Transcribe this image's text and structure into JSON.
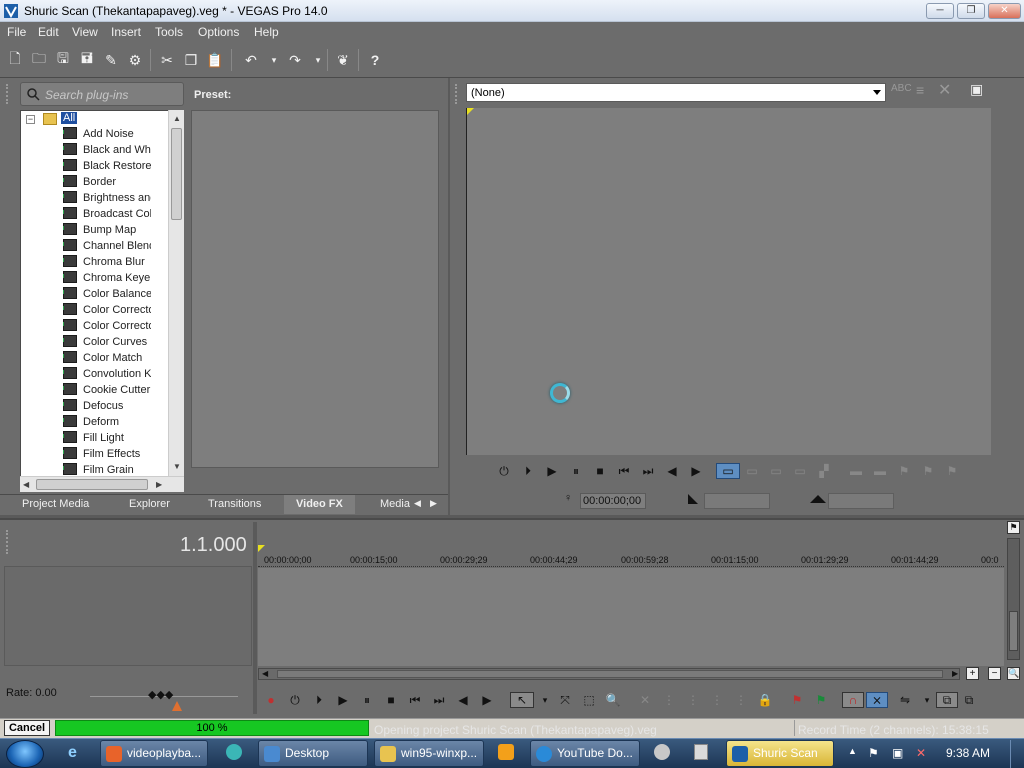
{
  "window": {
    "title": "Shuric Scan (Thekantapapaveg).veg * - VEGAS Pro 14.0",
    "min_glyph": "─",
    "max_glyph": "❐",
    "close_glyph": "✕"
  },
  "menu": {
    "items": [
      "File",
      "Edit",
      "View",
      "Insert",
      "Tools",
      "Options",
      "Help"
    ]
  },
  "toolbar": {
    "icons": [
      "new-project-icon",
      "open-icon",
      "save-icon",
      "save-as-icon",
      "render-as-icon",
      "properties-icon",
      "cut-icon",
      "copy-icon",
      "paste-icon",
      "undo-icon",
      "redo-icon",
      "plug-in-icon",
      "whats-this-icon"
    ]
  },
  "plugin_chooser": {
    "search_placeholder": "Search plug-ins",
    "preset_label": "Preset:",
    "root_label": "All",
    "items": [
      "Add Noise",
      "Black and White",
      "Black Restore",
      "Border",
      "Brightness and Contrast",
      "Broadcast Colors",
      "Bump Map",
      "Channel Blend",
      "Chroma Blur",
      "Chroma Keyer",
      "Color Balance",
      "Color Corrector",
      "Color Corrector (Secondary)",
      "Color Curves",
      "Color Match",
      "Convolution Kernel",
      "Cookie Cutter",
      "Defocus",
      "Deform",
      "Fill Light",
      "Film Effects",
      "Film Grain"
    ],
    "tabs": [
      "Project Media",
      "Explorer",
      "Transitions",
      "Video FX",
      "Media"
    ],
    "active_tab": "Video FX"
  },
  "preview": {
    "fx_select_value": "(None)",
    "timecode": "00:00:00;00"
  },
  "timeline": {
    "counter": "1.1.000",
    "ruler_labels": [
      "00:00:00;00",
      "00:00:15;00",
      "00:00:29;29",
      "00:00:44;29",
      "00:00:59;28",
      "00:01:15;00",
      "00:01:29;29",
      "00:01:44;29",
      "00:0"
    ],
    "rate_label": "Rate: 0.00"
  },
  "status": {
    "cancel_label": "Cancel",
    "progress_percent": 100,
    "progress_label": "100 %",
    "message": "Opening project Shuric Scan (Thekantapapaveg).veg",
    "record_time": "Record Time (2 channels): 15:38:15"
  },
  "taskbar": {
    "items": [
      "videoplayba...",
      "Desktop",
      "win95-winxp...",
      "YouTube Do...",
      "Shuric Scan"
    ],
    "clock": "9:38 AM"
  },
  "colors": {
    "panel_bg": "#6c6c6c",
    "preview_bg": "#7e7e7e",
    "progress_fill": "#16c722",
    "spinner": "#3fb7d3"
  }
}
